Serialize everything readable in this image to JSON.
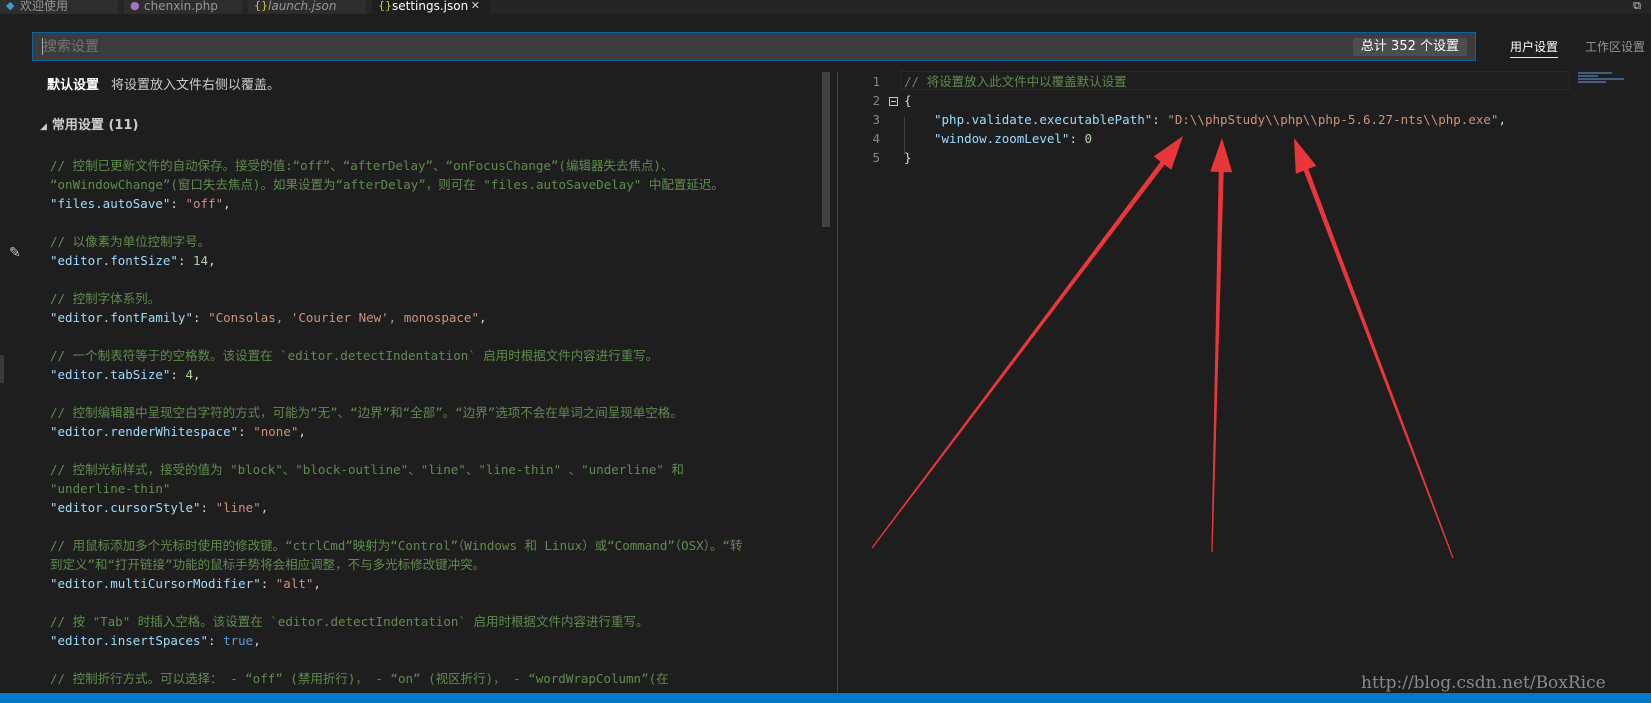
{
  "tabs": [
    {
      "label": "欢迎使用",
      "icon": "vscode-icon",
      "active": false
    },
    {
      "label": "chenxin.php",
      "icon": "php-icon",
      "active": false
    },
    {
      "label": "launch.json",
      "icon": "json-braces-icon",
      "active": false
    },
    {
      "label": "settings.json",
      "icon": "json-braces-icon",
      "active": true
    }
  ],
  "tab_close_glyph": "✕",
  "tabbar_right_glyph": "⧉",
  "search": {
    "placeholder": "搜索设置",
    "value": "",
    "count_label": "总计 352 个设置"
  },
  "scope_tabs": {
    "user": "用户设置",
    "workspace": "工作区设置"
  },
  "default_settings": {
    "title": "默认设置",
    "subtitle": "将设置放入文件右侧以覆盖。"
  },
  "section": {
    "label": "常用设置 (11)"
  },
  "left_lines": [
    {
      "t": "comment",
      "text": "// 控制已更新文件的自动保存。接受的值:“off”、“afterDelay”、“onFocusChange”(编辑器失去焦点)、"
    },
    {
      "t": "comment",
      "text": "“onWindowChange”(窗口失去焦点)。如果设置为“afterDelay”，则可在 \"files.autoSaveDelay\" 中配置延迟。"
    },
    {
      "t": "kv",
      "key": "\"files.autoSave\"",
      "val": "\"off\"",
      "vt": "str"
    },
    {
      "t": "blank"
    },
    {
      "t": "comment",
      "text": "// 以像素为单位控制字号。"
    },
    {
      "t": "kv",
      "key": "\"editor.fontSize\"",
      "val": "14",
      "vt": "num"
    },
    {
      "t": "blank"
    },
    {
      "t": "comment",
      "text": "// 控制字体系列。"
    },
    {
      "t": "kv",
      "key": "\"editor.fontFamily\"",
      "val": "\"Consolas, 'Courier New', monospace\"",
      "vt": "str"
    },
    {
      "t": "blank"
    },
    {
      "t": "comment",
      "text": "// 一个制表符等于的空格数。该设置在 `editor.detectIndentation` 启用时根据文件内容进行重写。"
    },
    {
      "t": "kv",
      "key": "\"editor.tabSize\"",
      "val": "4",
      "vt": "num"
    },
    {
      "t": "blank"
    },
    {
      "t": "comment",
      "text": "// 控制编辑器中呈现空白字符的方式，可能为“无”、“边界”和“全部”。“边界”选项不会在单词之间呈现单空格。"
    },
    {
      "t": "kv",
      "key": "\"editor.renderWhitespace\"",
      "val": "\"none\"",
      "vt": "str"
    },
    {
      "t": "blank"
    },
    {
      "t": "comment",
      "text": "// 控制光标样式，接受的值为 \"block\"、\"block-outline\"、\"line\"、\"line-thin\" 、\"underline\" 和"
    },
    {
      "t": "comment",
      "text": "\"underline-thin\""
    },
    {
      "t": "kv",
      "key": "\"editor.cursorStyle\"",
      "val": "\"line\"",
      "vt": "str"
    },
    {
      "t": "blank"
    },
    {
      "t": "comment",
      "text": "// 用鼠标添加多个光标时使用的修改键。“ctrlCmd”映射为“Control”（Windows 和 Linux）或“Command”（OSX）。“转"
    },
    {
      "t": "comment",
      "text": "到定义”和“打开链接”功能的鼠标手势将会相应调整，不与多光标修改键冲突。"
    },
    {
      "t": "kv",
      "key": "\"editor.multiCursorModifier\"",
      "val": "\"alt\"",
      "vt": "str"
    },
    {
      "t": "blank"
    },
    {
      "t": "comment",
      "text": "// 按 \"Tab\" 时插入空格。该设置在 `editor.detectIndentation` 启用时根据文件内容进行重写。"
    },
    {
      "t": "kv",
      "key": "\"editor.insertSpaces\"",
      "val": "true",
      "vt": "kw"
    },
    {
      "t": "blank"
    },
    {
      "t": "comment",
      "text": "// 控制折行方式。可以选择： - “off” (禁用折行)， - “on” (视区折行)， - “wordWrapColumn”(在"
    }
  ],
  "right_editor": {
    "line_numbers": [
      "1",
      "2",
      "3",
      "4",
      "5"
    ],
    "comment": "// 将设置放入此文件中以覆盖默认设置",
    "open_brace": "{",
    "close_brace": "}",
    "entries": [
      {
        "key": "\"php.validate.executablePath\"",
        "val": "\"D:\\\\phpStudy\\\\php\\\\php-5.6.27-nts\\\\php.exe\"",
        "vt": "str",
        "comma": true
      },
      {
        "key": "\"window.zoomLevel\"",
        "val": "0",
        "vt": "num",
        "comma": false
      }
    ]
  },
  "annotation_color": "#e8363a",
  "watermark": "http://blog.csdn.net/BoxRice"
}
